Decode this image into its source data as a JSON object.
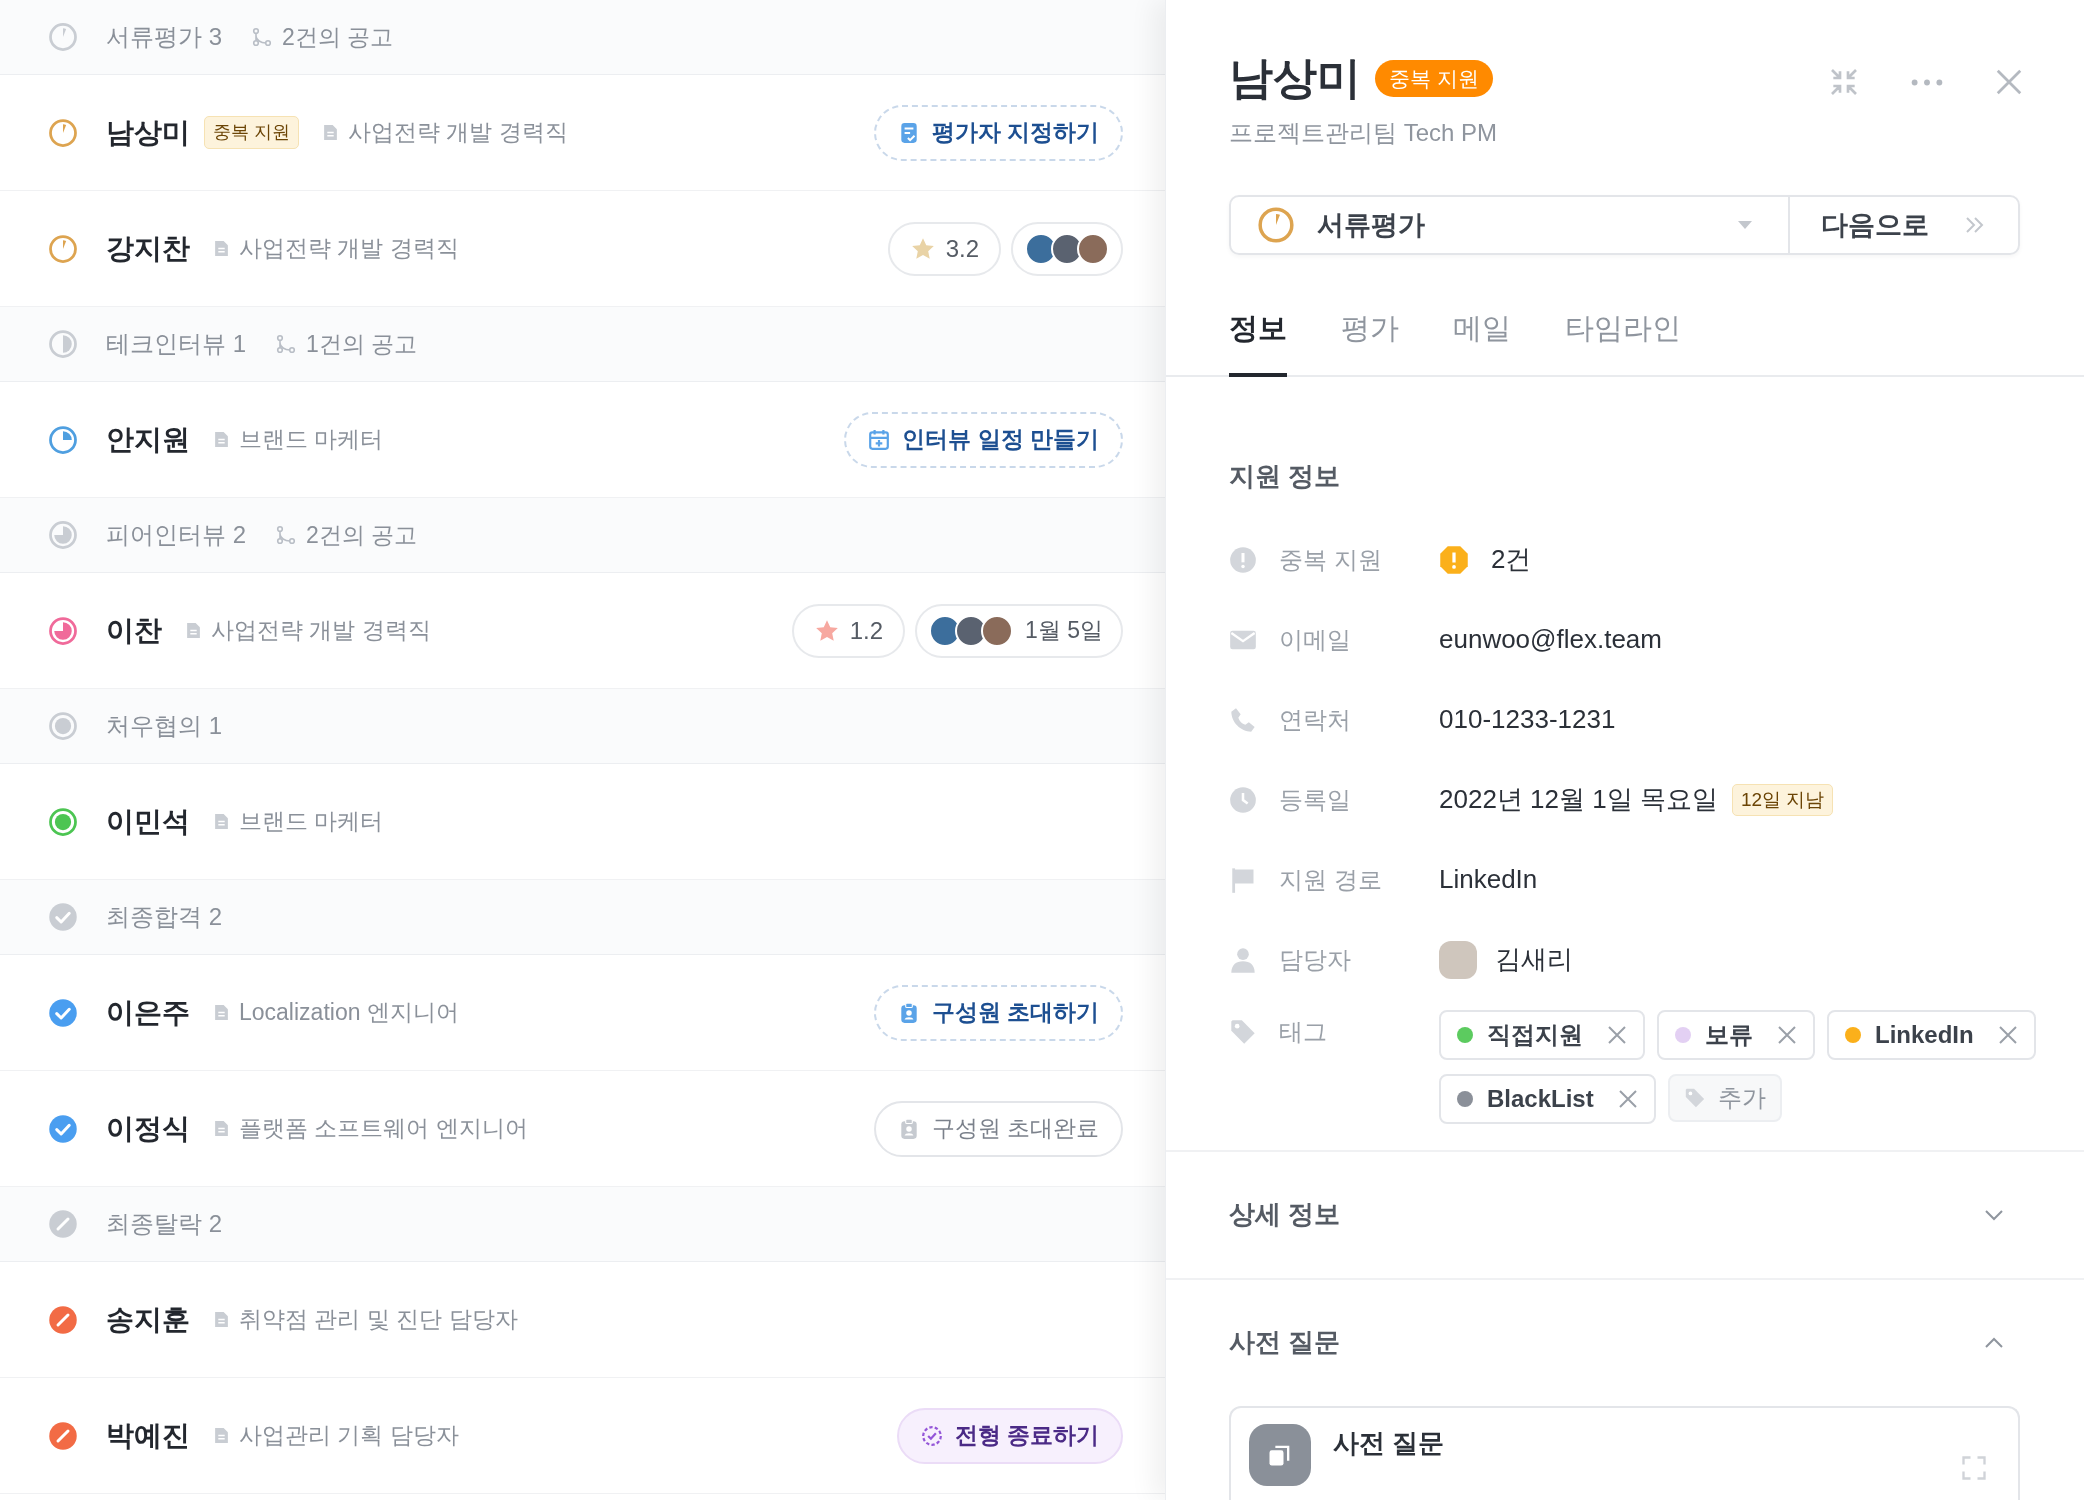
{
  "pipeline": [
    {
      "title": "서류평가 3",
      "kind": "review",
      "postings": "2건의 공고",
      "candidates": [
        {
          "name": "남상미",
          "kind": "review",
          "badge": "중복 지원",
          "job": "사업전략 개발 경력직",
          "action": {
            "kind": "assign",
            "label": "평가자 지정하기"
          }
        },
        {
          "name": "강지찬",
          "kind": "review",
          "job": "사업전략 개발 경력직",
          "rating": {
            "text": "3.2",
            "color": "#e9d3a6"
          },
          "evaluators": [
            {
              "kind": "photo"
            },
            {
              "kind": "photo"
            },
            {
              "kind": "photo"
            }
          ]
        }
      ]
    },
    {
      "title": "테크인터뷰 1",
      "kind": "half",
      "postings": "1건의 공고",
      "candidates": [
        {
          "name": "안지원",
          "kind": "quarter",
          "job": "브랜드 마케터",
          "action": {
            "kind": "schedule",
            "label": "인터뷰 일정 만들기"
          }
        }
      ]
    },
    {
      "title": "피어인터뷰 2",
      "kind": "three-quarter",
      "postings": "2건의 공고",
      "candidates": [
        {
          "name": "이찬",
          "kind": "three-quarter",
          "job": "사업전략 개발 경력직",
          "rating": {
            "text": "1.2",
            "color": "#f7a8a0"
          },
          "evaluators": [
            {
              "kind": "photo"
            },
            {
              "kind": "photo"
            },
            {
              "kind": "photo"
            }
          ],
          "date": "1월 5일"
        }
      ]
    },
    {
      "title": "처우협의 1",
      "kind": "dot",
      "candidates": [
        {
          "name": "이민석",
          "kind": "dot",
          "job": "브랜드 마케터"
        }
      ]
    },
    {
      "title": "최종합격 2",
      "kind": "passed",
      "candidates": [
        {
          "name": "이은주",
          "kind": "passed",
          "job": "Localization 엔지니어",
          "action": {
            "kind": "invite",
            "label": "구성원 초대하기"
          }
        },
        {
          "name": "이정식",
          "kind": "passed",
          "job": "플랫폼 소프트웨어 엔지니어",
          "action": {
            "kind": "invited",
            "label": "구성원 초대완료"
          }
        }
      ]
    },
    {
      "title": "최종탈락 2",
      "kind": "failed",
      "candidates": [
        {
          "name": "송지훈",
          "kind": "failed",
          "job": "취약점 관리 및 진단 담당자"
        },
        {
          "name": "박예진",
          "kind": "failed",
          "job": "사업관리 기획 담당자",
          "action": {
            "kind": "close",
            "label": "전형 종료하기"
          }
        }
      ]
    }
  ],
  "detail": {
    "name": "남상미",
    "badge": "중복 지원",
    "subtitle": "프로젝트관리팀 Tech PM",
    "stage": {
      "kind": "review",
      "label": "서류평가"
    },
    "next_button": "다음으로",
    "tabs": [
      {
        "label": "정보",
        "selected": true
      },
      {
        "label": "평가",
        "selected": false
      },
      {
        "label": "메일",
        "selected": false
      },
      {
        "label": "타임라인",
        "selected": false
      }
    ],
    "section_title": "지원 정보",
    "info": [
      {
        "kind": "duplicate",
        "label": "중복 지원",
        "value": "2건"
      },
      {
        "kind": "email",
        "label": "이메일",
        "value": "eunwoo@flex.team"
      },
      {
        "kind": "phone",
        "label": "연락처",
        "value": "010-1233-1231"
      },
      {
        "kind": "date",
        "label": "등록일",
        "value": "2022년 12월 1일 목요일",
        "badge": "12일 지남"
      },
      {
        "kind": "source",
        "label": "지원 경로",
        "value": "LinkedIn"
      },
      {
        "kind": "owner",
        "label": "담당자",
        "value": "김새리"
      },
      {
        "kind": "tags",
        "label": "태그",
        "tags": [
          {
            "label": "직접지원",
            "color": "#5ccb5f"
          },
          {
            "label": "보류",
            "color": "#e3d0f3"
          },
          {
            "label": "LinkedIn",
            "color": "#fbb01b"
          },
          {
            "label": "BlackList",
            "color": "#8b9099"
          }
        ],
        "add_label": "추가"
      }
    ],
    "sections": [
      {
        "title": "상세 정보",
        "expanded": false
      },
      {
        "title": "사전 질문",
        "expanded": true
      }
    ],
    "question_card": {
      "title": "사전 질문"
    }
  }
}
